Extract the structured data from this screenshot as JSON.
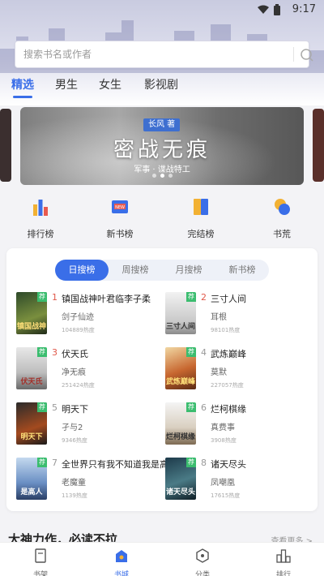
{
  "status_bar": {
    "time": "9:17"
  },
  "search": {
    "placeholder": "搜索书名或作者"
  },
  "tabs": [
    {
      "label": "精选",
      "active": true
    },
    {
      "label": "男生",
      "active": false
    },
    {
      "label": "女生",
      "active": false
    },
    {
      "label": "影视剧",
      "active": false
    }
  ],
  "banner": {
    "author_tag": "长风 著",
    "title": "密战无痕",
    "subtitle": "军事 · 谍战特工",
    "dots": 3,
    "active_dot": 1
  },
  "quick_nav": [
    {
      "label": "排行榜",
      "icon": "ranking-icon"
    },
    {
      "label": "新书榜",
      "icon": "new-book-icon"
    },
    {
      "label": "完结榜",
      "icon": "completed-icon"
    },
    {
      "label": "书荒",
      "icon": "book-shortage-icon"
    }
  ],
  "rank_tabs": [
    {
      "label": "日搜榜",
      "active": true
    },
    {
      "label": "周搜榜",
      "active": false
    },
    {
      "label": "月搜榜",
      "active": false
    },
    {
      "label": "新书榜",
      "active": false
    }
  ],
  "books": [
    {
      "rank": "1",
      "title": "镇国战神叶君临李子柔",
      "author": "剑子仙迹",
      "heat": "104889热度",
      "cover_text": "镇国战神"
    },
    {
      "rank": "2",
      "title": "三寸人间",
      "author": "耳根",
      "heat": "98101热度",
      "cover_text": "三寸人间"
    },
    {
      "rank": "3",
      "title": "伏天氏",
      "author": "净无痕",
      "heat": "251424热度",
      "cover_text": "伏天氏"
    },
    {
      "rank": "4",
      "title": "武炼巅峰",
      "author": "莫默",
      "heat": "227057热度",
      "cover_text": "武炼巅峰"
    },
    {
      "rank": "5",
      "title": "明天下",
      "author": "孑与2",
      "heat": "9346热度",
      "cover_text": "明天下"
    },
    {
      "rank": "6",
      "title": "烂柯棋缘",
      "author": "真费事",
      "heat": "3908热度",
      "cover_text": "烂柯棋缘"
    },
    {
      "rank": "7",
      "title": "全世界只有我不知道我是高人",
      "author": "老魔童",
      "heat": "1139热度",
      "cover_text": "是高人"
    },
    {
      "rank": "8",
      "title": "诸天尽头",
      "author": "凤嘲凰",
      "heat": "17615热度",
      "cover_text": "诸天尽头"
    }
  ],
  "badge_label": "荐",
  "section": {
    "title": "大神力作，必读不拉",
    "more": "查看更多 >"
  },
  "bottom_nav": [
    {
      "label": "书架",
      "active": false
    },
    {
      "label": "书城",
      "active": true
    },
    {
      "label": "分类",
      "active": false
    },
    {
      "label": "排行",
      "active": false
    }
  ],
  "colors": {
    "accent": "#3a6ee8",
    "rank_top": "#e0584a",
    "badge": "#3bbd6f"
  }
}
